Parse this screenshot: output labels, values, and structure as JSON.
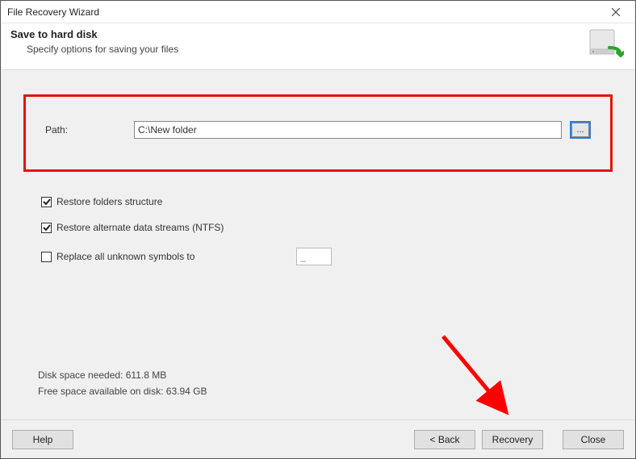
{
  "titlebar": {
    "title": "File Recovery Wizard"
  },
  "header": {
    "title": "Save to hard disk",
    "subtitle": "Specify options for saving your files"
  },
  "path": {
    "label": "Path:",
    "value": "C:\\New folder",
    "browse": "..."
  },
  "options": {
    "restore_folders": {
      "label": "Restore folders structure",
      "checked": true
    },
    "restore_ads": {
      "label": "Restore alternate data streams (NTFS)",
      "checked": true
    },
    "replace_symbols": {
      "label": "Replace all unknown symbols to",
      "checked": false,
      "value": "_"
    }
  },
  "info": {
    "disk_needed_label": "Disk space needed:",
    "disk_needed_value": "611.8 MB",
    "free_space_label": "Free space available on disk:",
    "free_space_value": "63.94 GB"
  },
  "footer": {
    "help": "Help",
    "back": "< Back",
    "recovery": "Recovery",
    "close": "Close"
  }
}
